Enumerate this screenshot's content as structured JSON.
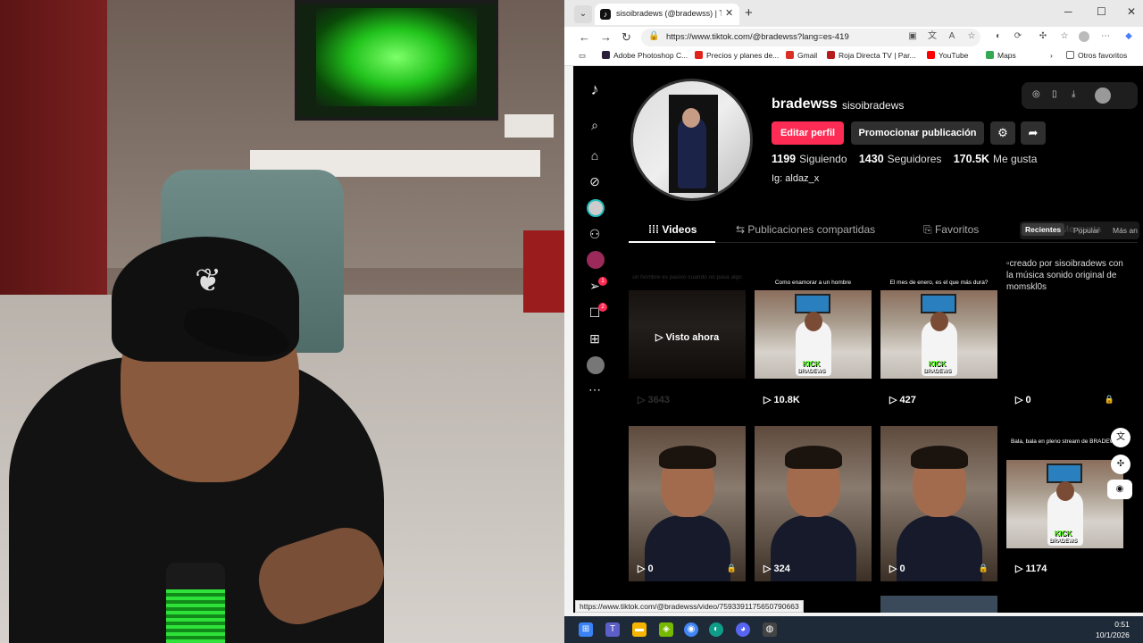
{
  "browser": {
    "tab_title": "sisoibradews (@bradewss) | TikTok",
    "url": "https://www.tiktok.com/@bradewss?lang=es-419",
    "bookmarks": [
      "Adobe Photoshop C...",
      "Precios y planes de...",
      "Gmail",
      "Roja Directa TV | Par...",
      "YouTube",
      "Maps"
    ],
    "other_favorites": "Otros favoritos",
    "status_url": "https://www.tiktok.com/@bradewss/video/7593391175650790663"
  },
  "profile": {
    "username": "bradewss",
    "nickname": "sisoibradews",
    "edit_button": "Editar perfil",
    "promote_button": "Promocionar publicación",
    "following_count": "1199",
    "following_label": "Siguiendo",
    "followers_count": "1430",
    "followers_label": "Seguidores",
    "likes_count": "170.5K",
    "likes_label": "Me gusta",
    "bio": "Ig: aldaz_x"
  },
  "tabs": {
    "videos": "Videos",
    "reposts": "Publicaciones compartidas",
    "favorites": "Favoritos",
    "liked": "Me gusta"
  },
  "sort": {
    "recent": "Recientes",
    "popular": "Popular",
    "older": "Más an"
  },
  "videos": [
    {
      "caption": "un hombre es pasivo cuando no pasa algo",
      "views": "3643",
      "overlay": "Visto ahora"
    },
    {
      "caption": "Como enamorar a un hombre",
      "views": "10.8K"
    },
    {
      "caption": "El mes de enero, es el que más dura?",
      "views": "427"
    },
    {
      "alt": "creado por sisoibradews con la música sonido original de momskl0s",
      "views": "0"
    },
    {
      "views": "0"
    },
    {
      "views": "324"
    },
    {
      "views": "0"
    },
    {
      "caption": "Bala, bala en pleno stream de BRADEWS",
      "views": "1174"
    }
  ],
  "kick_logo": {
    "word": "KICK",
    "channel": "BRADEWS"
  },
  "rail_badges": {
    "inbox": "1",
    "messages": "2"
  },
  "taskbar": {
    "time": "0:51",
    "date": "10/1/2026"
  },
  "colors": {
    "accent": "#fe2c55",
    "background": "#000000",
    "kick_green": "#53fc18"
  }
}
